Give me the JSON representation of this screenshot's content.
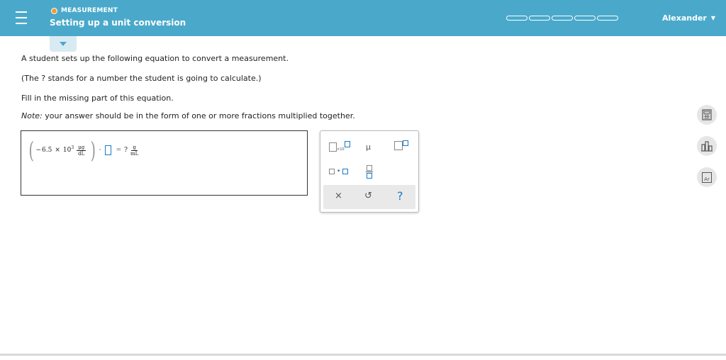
{
  "header": {
    "topic": "MEASUREMENT",
    "title": "Setting up a unit conversion",
    "user": "Alexander",
    "progress_segments": 5,
    "colors": {
      "bar": "#4aa9cb",
      "topic_dot": "#f39a35"
    }
  },
  "question": {
    "line1": "A student sets up the following equation to convert a measurement.",
    "line2": "(The ? stands for a number the student is going to calculate.)",
    "line3": "Fill in the missing part of this equation.",
    "note_label": "Note:",
    "note_text": " your answer should be in the form of one or more fractions multiplied together."
  },
  "equation": {
    "sign": "−",
    "mantissa": "6.5",
    "times": "×",
    "base": "10",
    "exponent": "3",
    "num_unit": "μg",
    "den_unit": "dL",
    "dot": "·",
    "equals": "=",
    "unknown": "?",
    "result_num": "g",
    "result_den": "mL"
  },
  "keypad": {
    "x10_label": "×10",
    "mu": "μ",
    "dot": "•",
    "clear": "×",
    "undo": "↺",
    "help": "?"
  },
  "sidebar": {
    "calculator": "calculator-icon",
    "chart": "chart-icon",
    "periodic": "periodic-table-icon",
    "periodic_label": "Ar"
  }
}
